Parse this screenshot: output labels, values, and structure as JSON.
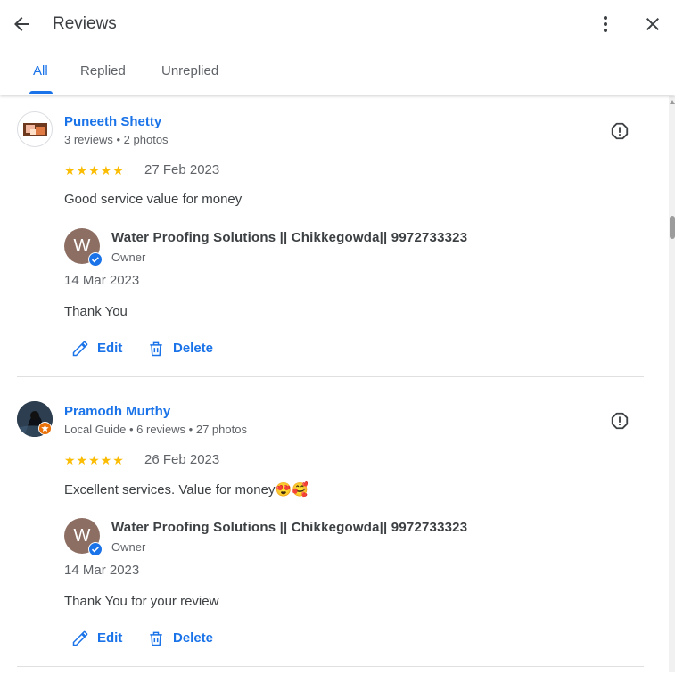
{
  "header": {
    "title": "Reviews",
    "tabs": [
      {
        "label": "All",
        "active": true
      },
      {
        "label": "Replied",
        "active": false
      },
      {
        "label": "Unreplied",
        "active": false
      }
    ]
  },
  "colors": {
    "accent": "#1a73e8",
    "star": "#fbbc04",
    "owner_avatar": "#8d6e63",
    "text_secondary": "#5f6368"
  },
  "reviews": [
    {
      "reviewer_name": "Puneeth Shetty",
      "reviewer_meta": "3 reviews • 2 photos",
      "rating": 5,
      "stars": "★★★★★",
      "date": "27 Feb 2023",
      "text": "Good service value for money",
      "reply": {
        "owner_initial": "W",
        "owner_name": "Water Proofing Solutions || Chikkegowda|| 9972733323",
        "owner_role": "Owner",
        "date": "14 Mar 2023",
        "text": "Thank You"
      },
      "edit_label": "Edit",
      "delete_label": "Delete"
    },
    {
      "reviewer_name": "Pramodh Murthy",
      "reviewer_meta": "Local Guide • 6 reviews • 27 photos",
      "rating": 5,
      "stars": "★★★★★",
      "date": "26 Feb 2023",
      "text": "Excellent services. Value for money😍🥰",
      "reply": {
        "owner_initial": "W",
        "owner_name": "Water Proofing Solutions || Chikkegowda|| 9972733323",
        "owner_role": "Owner",
        "date": "14 Mar 2023",
        "text": "Thank You for your review"
      },
      "edit_label": "Edit",
      "delete_label": "Delete"
    }
  ]
}
